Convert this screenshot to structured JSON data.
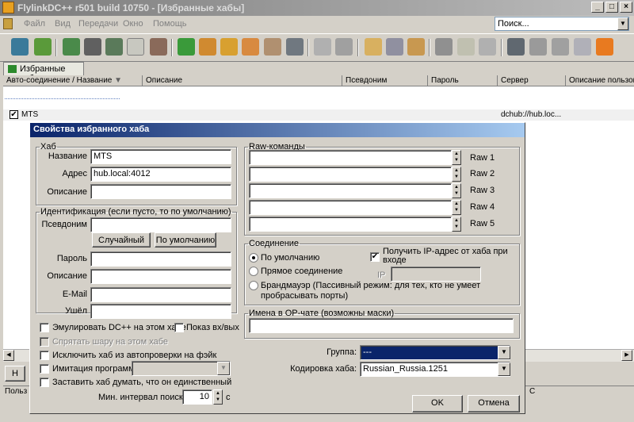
{
  "window": {
    "title": "FlylinkDC++ r501 build 10750 - [Избранные хабы]",
    "minimize": "_",
    "maximize": "□",
    "close": "×"
  },
  "menu": {
    "items": [
      "Файл",
      "Вид",
      "Передачи",
      "Окно",
      "Помощь"
    ]
  },
  "search": {
    "placeholder": "Поиск..."
  },
  "toolbar": {
    "icons": [
      "hub-icon",
      "user-icon",
      "reconnect-icon",
      "plug-icon",
      "queue-icon",
      "favorites-icon",
      "users-icon",
      "download-icon",
      "upload-icon",
      "shared-icon",
      "files-icon",
      "monitor-icon",
      "search-icon",
      "adl-search-icon",
      "folder-icon",
      "transfers-icon",
      "list-icon",
      "notepad-icon",
      "settings-icon",
      "net-icon",
      "refresh-icon",
      "close-all-icon",
      "options-icon",
      "rss-icon"
    ]
  },
  "tabs": [
    {
      "label": "Избранные хабы"
    }
  ],
  "list": {
    "columns": [
      "Авто-соединение / Название",
      "Описание",
      "Псевдоним",
      "Пароль",
      "Сервер",
      "Описание пользов"
    ],
    "rows": [
      {
        "checked": "✔",
        "name": "MTS",
        "server": "dchub://hub.loc..."
      }
    ]
  },
  "bottom": {
    "new_button": "Н",
    "status_left": "Польз",
    "status_mid": "С"
  },
  "dialog": {
    "title": "Свойства избранного хаба",
    "hub": {
      "legend": "Хаб",
      "name_label": "Название",
      "name_value": "MTS",
      "address_label": "Адрес",
      "address_value": "hub.local:4012",
      "description_label": "Описание",
      "description_value": ""
    },
    "ident": {
      "legend": "Идентификация (если пусто, то по умолчанию)",
      "nick_label": "Псевдоним",
      "nick_value": "",
      "random_button": "Случайный",
      "default_button": "По умолчанию",
      "password_label": "Пароль",
      "description_label": "Описание",
      "email_label": "E-Mail",
      "gone_label": "Ушёл"
    },
    "options": {
      "emulate_dc": "Эмулировать DC++ на этом хабе",
      "show_joins": "Показ вх/вых",
      "hide_share": "Спрятать шару на этом хабе",
      "exclude_fake": "Исключить хаб из автопроверки на фэйк",
      "imitate_program": "Имитация программы",
      "only_one": "Заставить хаб думать, что он единственный",
      "min_search_label": "Мин. интервал поиска",
      "min_search_value": "10",
      "min_search_unit": "с"
    },
    "raw": {
      "legend": "Raw-команды",
      "labels": [
        "Raw 1",
        "Raw 2",
        "Raw 3",
        "Raw 4",
        "Raw 5"
      ]
    },
    "connection": {
      "legend": "Соединение",
      "default": "По умолчанию",
      "direct": "Прямое соединение",
      "firewall": "Брандмауэр (Пассивный режим: для тех, кто не умеет пробрасывать порты)",
      "get_ip": "Получить IP-адрес от хаба при входе",
      "ip_label": "IP"
    },
    "op_names": {
      "legend": "Имена в OP-чате (возможны маски)"
    },
    "group_label": "Группа:",
    "group_value": "---",
    "encoding_label": "Кодировка хаба:",
    "encoding_value": "Russian_Russia.1251",
    "ok": "OK",
    "cancel": "Отмена"
  }
}
